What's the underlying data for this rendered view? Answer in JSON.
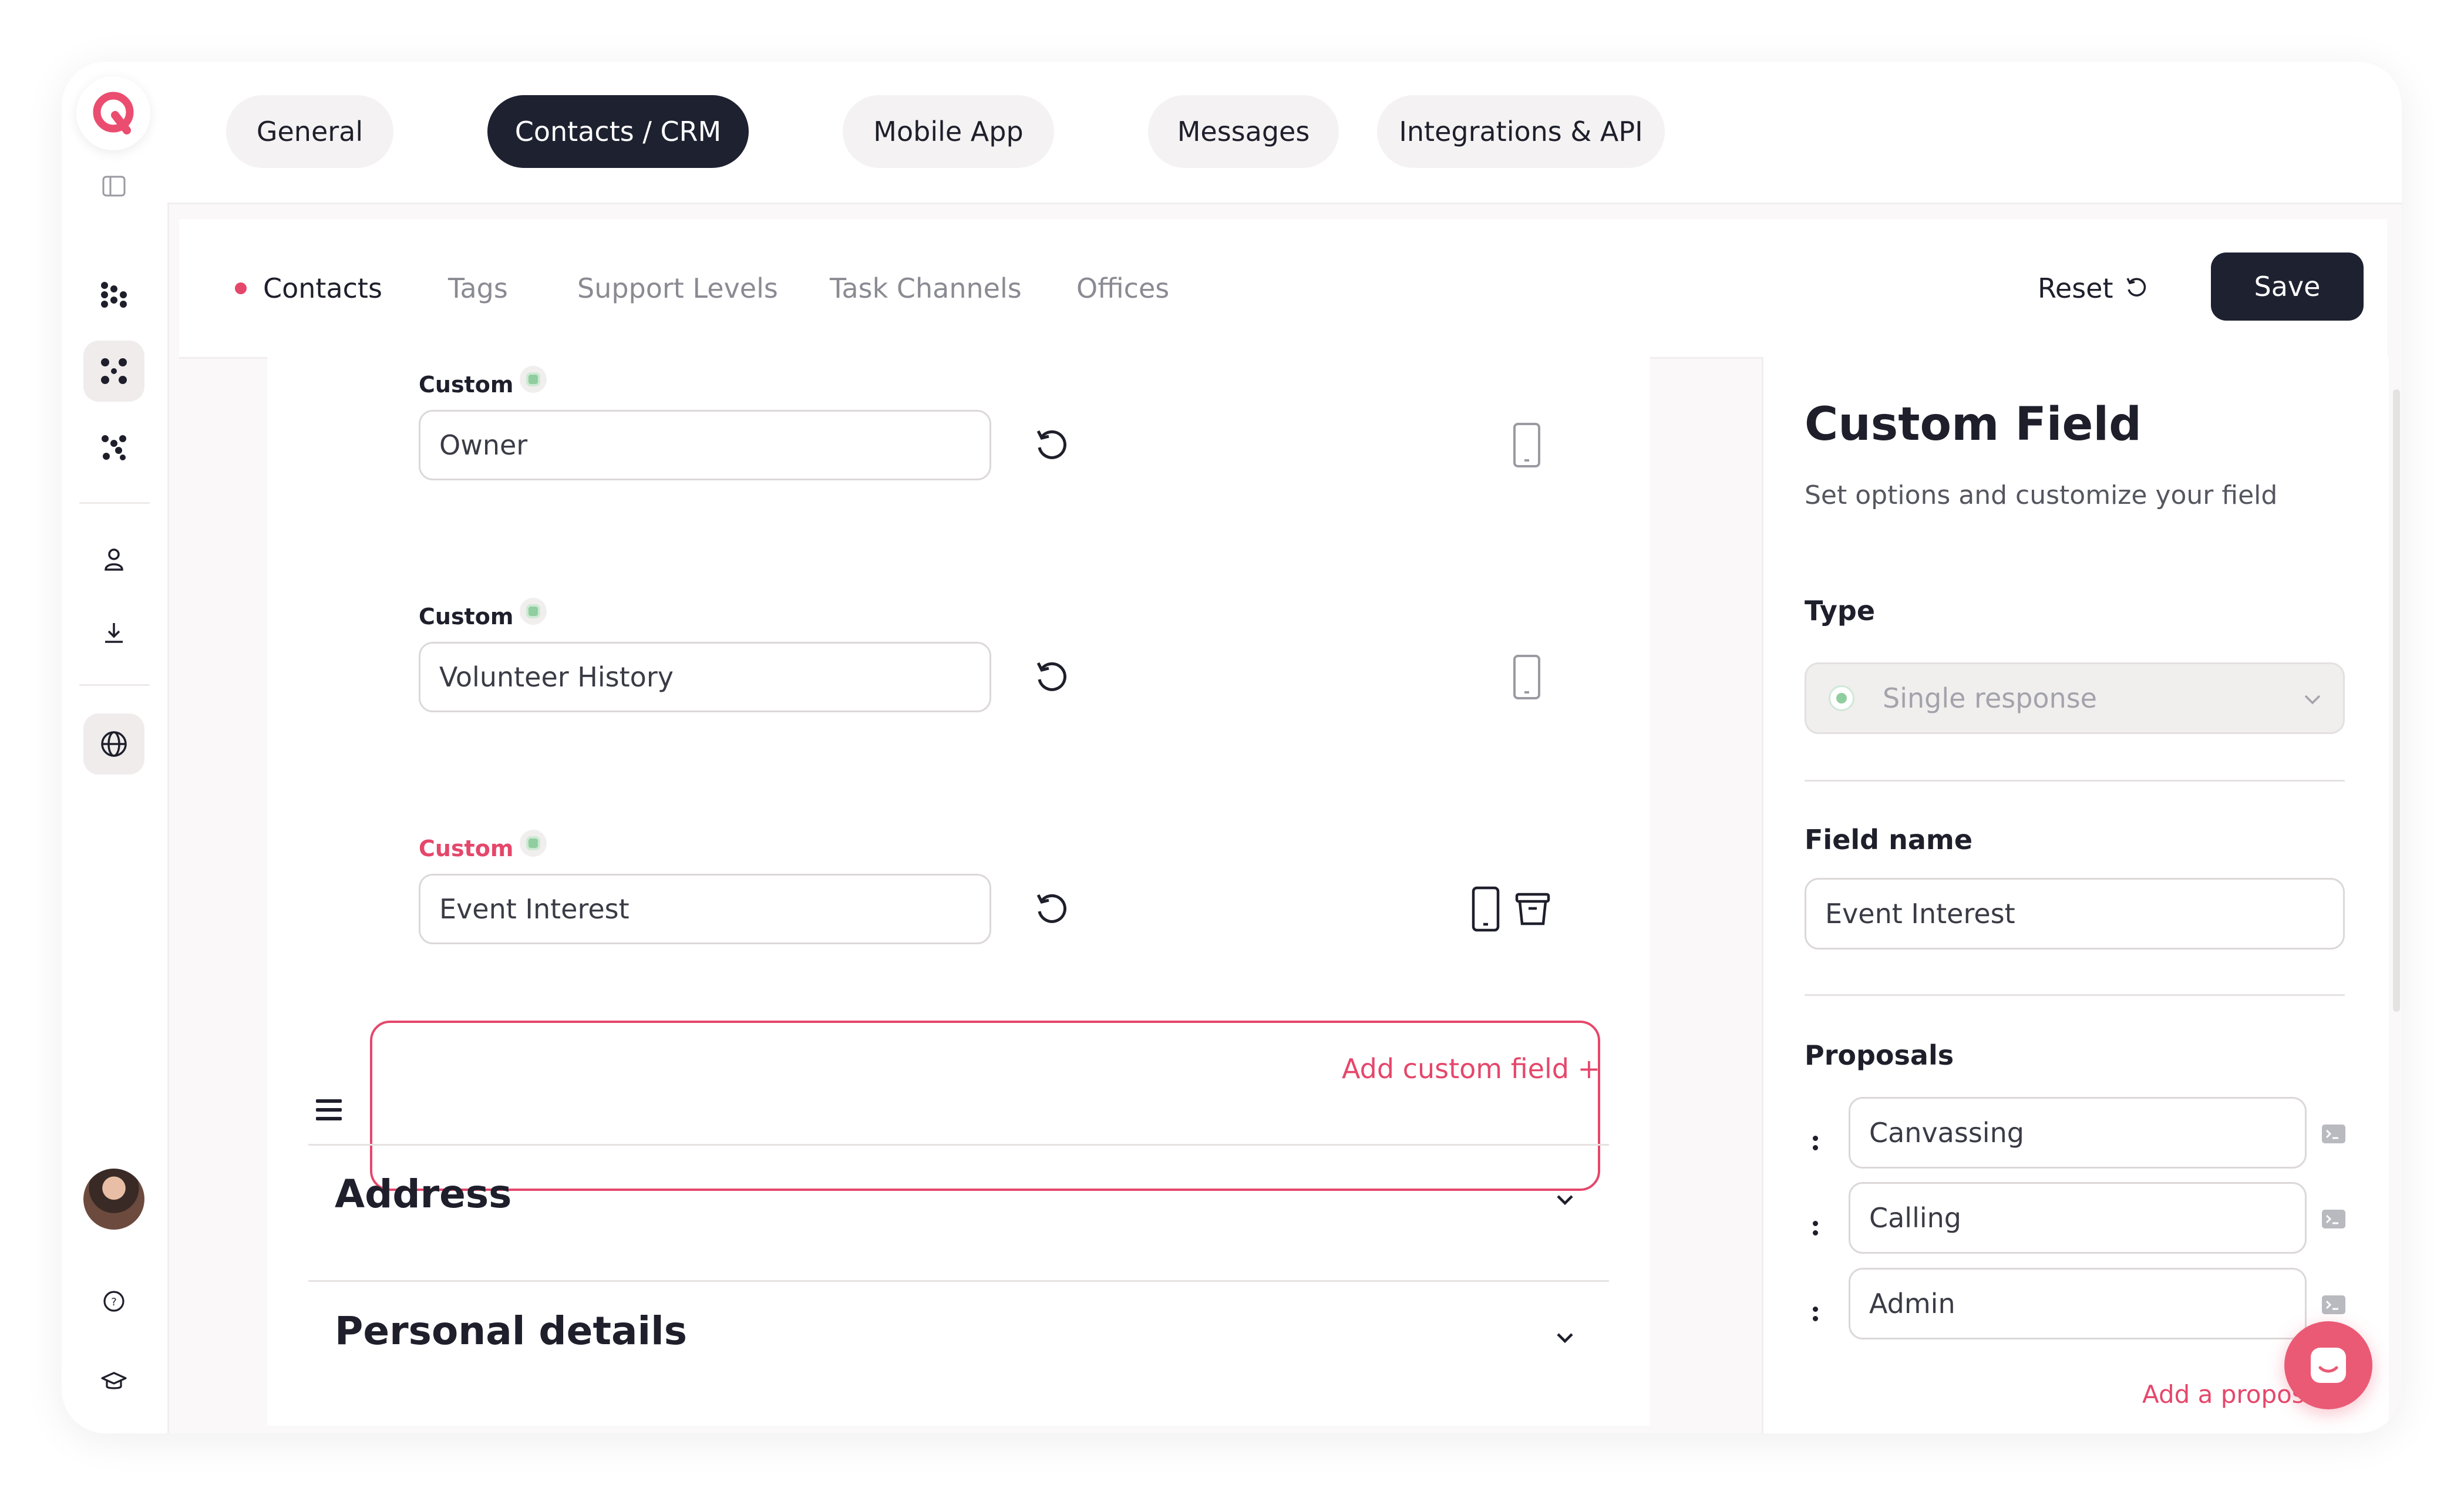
{
  "top_tabs": [
    {
      "label": "General"
    },
    {
      "label": "Contacts / CRM"
    },
    {
      "label": "Mobile App"
    },
    {
      "label": "Messages"
    },
    {
      "label": "Integrations & API"
    }
  ],
  "sub_tabs": [
    {
      "label": "Contacts"
    },
    {
      "label": "Tags"
    },
    {
      "label": "Support Levels"
    },
    {
      "label": "Task Channels"
    },
    {
      "label": "Offices"
    }
  ],
  "actions": {
    "reset_label": "Reset",
    "save_label": "Save"
  },
  "fields": [
    {
      "tag": "Custom",
      "value": "Owner"
    },
    {
      "tag": "Custom",
      "value": "Volunteer History"
    },
    {
      "tag": "Custom",
      "value": "Event Interest"
    }
  ],
  "add_custom_field_label": "Add custom field +",
  "sections": [
    {
      "title": "Address"
    },
    {
      "title": "Personal details"
    }
  ],
  "right_panel": {
    "title": "Custom Field",
    "subtitle": "Set options and customize your field",
    "type_label": "Type",
    "type_value": "Single response",
    "field_name_label": "Field name",
    "field_name_value": "Event Interest",
    "proposals_label": "Proposals",
    "proposals": [
      "Canvassing",
      "Calling",
      "Admin"
    ],
    "add_proposal_label": "Add a proposal +"
  },
  "colors": {
    "accent": "#e5476b",
    "dark": "#1e2130",
    "success": "#8fce9e"
  }
}
